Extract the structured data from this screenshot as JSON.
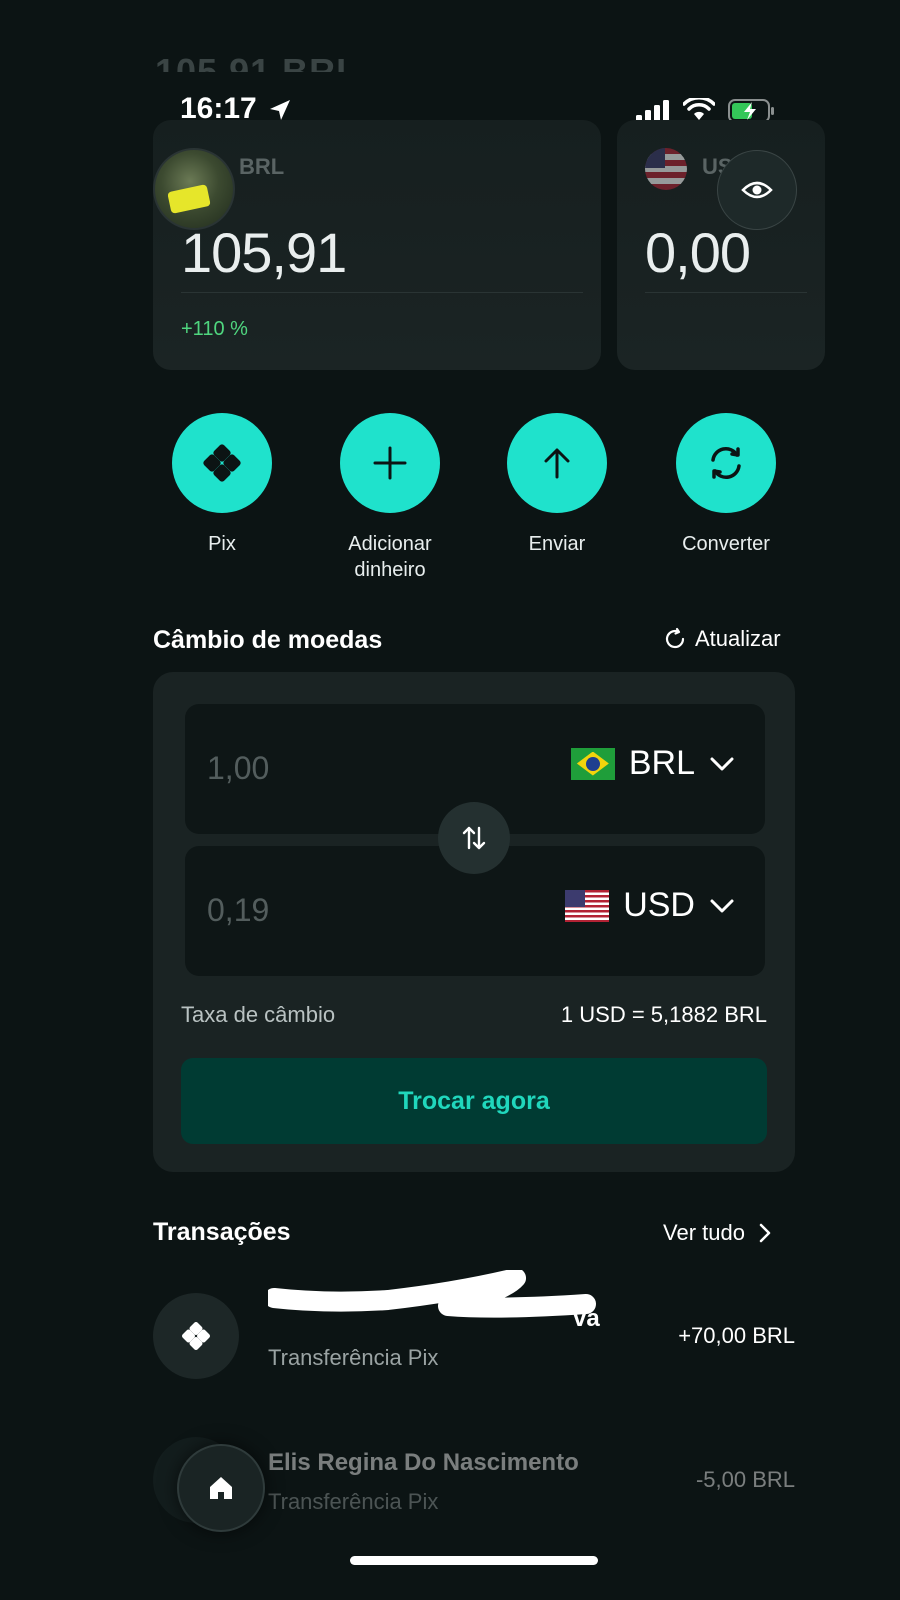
{
  "status_bar": {
    "time": "16:17"
  },
  "scrolled_header": {
    "text": "105,91 BRL"
  },
  "accounts": [
    {
      "code": "BRL",
      "amount": "105,91",
      "change": "+110 %"
    },
    {
      "code": "USD",
      "amount": "0,00"
    }
  ],
  "actions": [
    {
      "label": "Pix",
      "icon": "pix-icon"
    },
    {
      "label": "Adicionar dinheiro",
      "icon": "plus-icon"
    },
    {
      "label": "Enviar",
      "icon": "arrow-up-icon"
    },
    {
      "label": "Converter",
      "icon": "convert-icon"
    }
  ],
  "exchange": {
    "title": "Câmbio de moedas",
    "refresh_label": "Atualizar",
    "from": {
      "value": "1,00",
      "currency": "BRL"
    },
    "to": {
      "value": "0,19",
      "currency": "USD"
    },
    "rate_label": "Taxa de câmbio",
    "rate_value": "1 USD = 5,1882 BRL",
    "button": "Trocar agora"
  },
  "transactions": {
    "title": "Transações",
    "see_all": "Ver tudo",
    "items": [
      {
        "name": "va",
        "type": "Transferência Pix",
        "amount": "+70,00 BRL"
      },
      {
        "name": "Elis Regina Do Nascimento",
        "type": "Transferência Pix",
        "amount": "-5,00 BRL"
      }
    ]
  },
  "colors": {
    "accent": "#1fe2cc",
    "background": "#0c1414",
    "positive": "#4fd67f"
  }
}
